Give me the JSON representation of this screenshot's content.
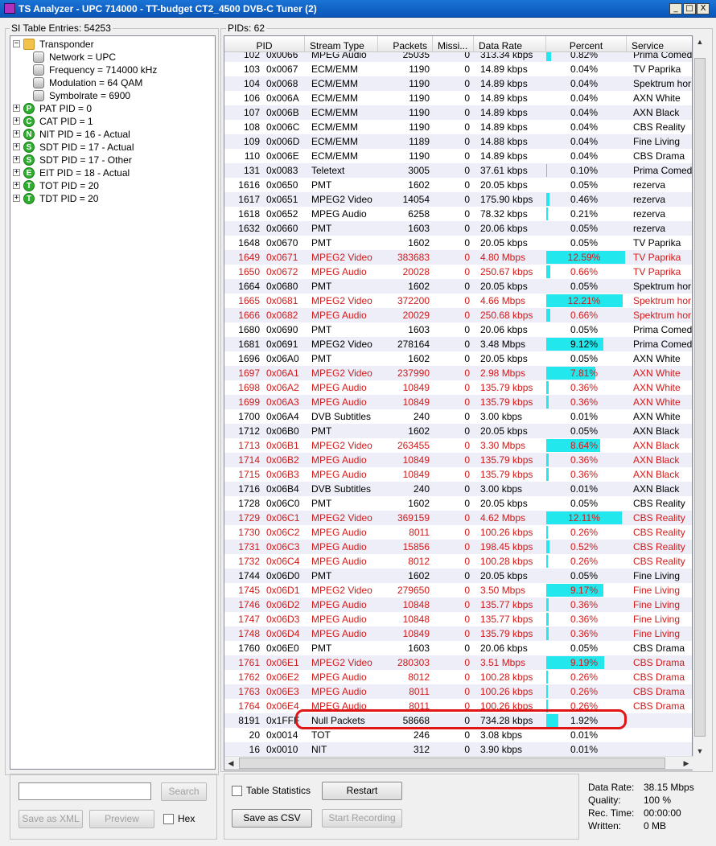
{
  "window": {
    "title": "TS Analyzer - UPC 714000 - TT-budget CT2_4500 DVB-C Tuner (2)",
    "minimize": "_",
    "maximize": "□",
    "close": "X"
  },
  "left_panel": {
    "label": "SI Table Entries: 54253",
    "tree": [
      {
        "label": "Transponder",
        "icon": "folder-icon",
        "expander": "−",
        "level": 0
      },
      {
        "label": "Network = UPC",
        "icon": "gray-node-icon",
        "level": 1
      },
      {
        "label": "Frequency = 714000 kHz",
        "icon": "gray-node-icon",
        "level": 1
      },
      {
        "label": "Modulation = 64 QAM",
        "icon": "gray-node-icon",
        "level": 1
      },
      {
        "label": "Symbolrate = 6900",
        "icon": "gray-node-icon",
        "level": 1
      },
      {
        "label": "PAT PID = 0",
        "icon": "green-node-icon",
        "letter": "P",
        "expander": "+",
        "level": 0
      },
      {
        "label": "CAT PID = 1",
        "icon": "green-node-icon",
        "letter": "C",
        "expander": "+",
        "level": 0
      },
      {
        "label": "NIT PID = 16 - Actual",
        "icon": "green-node-icon",
        "letter": "N",
        "expander": "+",
        "level": 0
      },
      {
        "label": "SDT PID = 17 - Actual",
        "icon": "green-node-icon",
        "letter": "S",
        "expander": "+",
        "level": 0
      },
      {
        "label": "SDT PID = 17 - Other",
        "icon": "green-node-icon",
        "letter": "S",
        "expander": "+",
        "level": 0
      },
      {
        "label": "EIT PID = 18 - Actual",
        "icon": "green-node-icon",
        "letter": "E",
        "expander": "+",
        "level": 0
      },
      {
        "label": "TOT PID = 20",
        "icon": "green-node-icon",
        "letter": "T",
        "expander": "+",
        "level": 0
      },
      {
        "label": "TDT PID = 20",
        "icon": "green-node-icon",
        "letter": "T",
        "expander": "+",
        "level": 0
      }
    ],
    "search_placeholder": "",
    "search_label": "Search",
    "save_xml_label": "Save as XML",
    "preview_label": "Preview",
    "hex_label": "Hex"
  },
  "right_panel": {
    "label": "PIDs: 62",
    "columns": [
      "PID",
      "Stream Type",
      "Packets",
      "Missi...",
      "Data Rate",
      "Percent",
      "Service"
    ],
    "rows": [
      {
        "pid": "102",
        "hex": "0x0066",
        "type": "MPEG Audio",
        "packets": "25035",
        "missing": "0",
        "rate": "313.34 kbps",
        "percent": "0.82%",
        "pct": 0.82,
        "service": "Prima Comed",
        "red": false,
        "clipped": true
      },
      {
        "pid": "103",
        "hex": "0x0067",
        "type": "ECM/EMM",
        "packets": "1190",
        "missing": "0",
        "rate": "14.89 kbps",
        "percent": "0.04%",
        "pct": 0.04,
        "service": "TV Paprika",
        "red": false
      },
      {
        "pid": "104",
        "hex": "0x0068",
        "type": "ECM/EMM",
        "packets": "1190",
        "missing": "0",
        "rate": "14.89 kbps",
        "percent": "0.04%",
        "pct": 0.04,
        "service": "Spektrum hor",
        "red": false
      },
      {
        "pid": "106",
        "hex": "0x006A",
        "type": "ECM/EMM",
        "packets": "1190",
        "missing": "0",
        "rate": "14.89 kbps",
        "percent": "0.04%",
        "pct": 0.04,
        "service": "AXN White",
        "red": false
      },
      {
        "pid": "107",
        "hex": "0x006B",
        "type": "ECM/EMM",
        "packets": "1190",
        "missing": "0",
        "rate": "14.89 kbps",
        "percent": "0.04%",
        "pct": 0.04,
        "service": "AXN Black",
        "red": false
      },
      {
        "pid": "108",
        "hex": "0x006C",
        "type": "ECM/EMM",
        "packets": "1190",
        "missing": "0",
        "rate": "14.89 kbps",
        "percent": "0.04%",
        "pct": 0.04,
        "service": "CBS Reality",
        "red": false
      },
      {
        "pid": "109",
        "hex": "0x006D",
        "type": "ECM/EMM",
        "packets": "1189",
        "missing": "0",
        "rate": "14.88 kbps",
        "percent": "0.04%",
        "pct": 0.04,
        "service": "Fine Living",
        "red": false
      },
      {
        "pid": "110",
        "hex": "0x006E",
        "type": "ECM/EMM",
        "packets": "1190",
        "missing": "0",
        "rate": "14.89 kbps",
        "percent": "0.04%",
        "pct": 0.04,
        "service": "CBS Drama",
        "red": false
      },
      {
        "pid": "131",
        "hex": "0x0083",
        "type": "Teletext",
        "packets": "3005",
        "missing": "0",
        "rate": "37.61 kbps",
        "percent": "0.10%",
        "pct": 0.1,
        "service": "Prima Comed",
        "red": false
      },
      {
        "pid": "1616",
        "hex": "0x0650",
        "type": "PMT",
        "packets": "1602",
        "missing": "0",
        "rate": "20.05 kbps",
        "percent": "0.05%",
        "pct": 0.05,
        "service": "rezerva",
        "red": false
      },
      {
        "pid": "1617",
        "hex": "0x0651",
        "type": "MPEG2 Video",
        "packets": "14054",
        "missing": "0",
        "rate": "175.90 kbps",
        "percent": "0.46%",
        "pct": 0.46,
        "service": "rezerva",
        "red": false
      },
      {
        "pid": "1618",
        "hex": "0x0652",
        "type": "MPEG Audio",
        "packets": "6258",
        "missing": "0",
        "rate": "78.32 kbps",
        "percent": "0.21%",
        "pct": 0.21,
        "service": "rezerva",
        "red": false
      },
      {
        "pid": "1632",
        "hex": "0x0660",
        "type": "PMT",
        "packets": "1603",
        "missing": "0",
        "rate": "20.06 kbps",
        "percent": "0.05%",
        "pct": 0.05,
        "service": "rezerva",
        "red": false
      },
      {
        "pid": "1648",
        "hex": "0x0670",
        "type": "PMT",
        "packets": "1602",
        "missing": "0",
        "rate": "20.05 kbps",
        "percent": "0.05%",
        "pct": 0.05,
        "service": "TV Paprika",
        "red": false
      },
      {
        "pid": "1649",
        "hex": "0x0671",
        "type": "MPEG2 Video",
        "packets": "383683",
        "missing": "0",
        "rate": "4.80 Mbps",
        "percent": "12.59%",
        "pct": 12.59,
        "service": "TV Paprika",
        "red": true
      },
      {
        "pid": "1650",
        "hex": "0x0672",
        "type": "MPEG Audio",
        "packets": "20028",
        "missing": "0",
        "rate": "250.67 kbps",
        "percent": "0.66%",
        "pct": 0.66,
        "service": "TV Paprika",
        "red": true
      },
      {
        "pid": "1664",
        "hex": "0x0680",
        "type": "PMT",
        "packets": "1602",
        "missing": "0",
        "rate": "20.05 kbps",
        "percent": "0.05%",
        "pct": 0.05,
        "service": "Spektrum hor",
        "red": false
      },
      {
        "pid": "1665",
        "hex": "0x0681",
        "type": "MPEG2 Video",
        "packets": "372200",
        "missing": "0",
        "rate": "4.66 Mbps",
        "percent": "12.21%",
        "pct": 12.21,
        "service": "Spektrum hor",
        "red": true
      },
      {
        "pid": "1666",
        "hex": "0x0682",
        "type": "MPEG Audio",
        "packets": "20029",
        "missing": "0",
        "rate": "250.68 kbps",
        "percent": "0.66%",
        "pct": 0.66,
        "service": "Spektrum hor",
        "red": true
      },
      {
        "pid": "1680",
        "hex": "0x0690",
        "type": "PMT",
        "packets": "1603",
        "missing": "0",
        "rate": "20.06 kbps",
        "percent": "0.05%",
        "pct": 0.05,
        "service": "Prima Comed",
        "red": false
      },
      {
        "pid": "1681",
        "hex": "0x0691",
        "type": "MPEG2 Video",
        "packets": "278164",
        "missing": "0",
        "rate": "3.48 Mbps",
        "percent": "9.12%",
        "pct": 9.12,
        "service": "Prima Comed",
        "red": false
      },
      {
        "pid": "1696",
        "hex": "0x06A0",
        "type": "PMT",
        "packets": "1602",
        "missing": "0",
        "rate": "20.05 kbps",
        "percent": "0.05%",
        "pct": 0.05,
        "service": "AXN White",
        "red": false
      },
      {
        "pid": "1697",
        "hex": "0x06A1",
        "type": "MPEG2 Video",
        "packets": "237990",
        "missing": "0",
        "rate": "2.98 Mbps",
        "percent": "7.81%",
        "pct": 7.81,
        "service": "AXN White",
        "red": true
      },
      {
        "pid": "1698",
        "hex": "0x06A2",
        "type": "MPEG Audio",
        "packets": "10849",
        "missing": "0",
        "rate": "135.79 kbps",
        "percent": "0.36%",
        "pct": 0.36,
        "service": "AXN White",
        "red": true
      },
      {
        "pid": "1699",
        "hex": "0x06A3",
        "type": "MPEG Audio",
        "packets": "10849",
        "missing": "0",
        "rate": "135.79 kbps",
        "percent": "0.36%",
        "pct": 0.36,
        "service": "AXN White",
        "red": true
      },
      {
        "pid": "1700",
        "hex": "0x06A4",
        "type": "DVB Subtitles",
        "packets": "240",
        "missing": "0",
        "rate": "3.00 kbps",
        "percent": "0.01%",
        "pct": 0.01,
        "service": "AXN White",
        "red": false
      },
      {
        "pid": "1712",
        "hex": "0x06B0",
        "type": "PMT",
        "packets": "1602",
        "missing": "0",
        "rate": "20.05 kbps",
        "percent": "0.05%",
        "pct": 0.05,
        "service": "AXN Black",
        "red": false
      },
      {
        "pid": "1713",
        "hex": "0x06B1",
        "type": "MPEG2 Video",
        "packets": "263455",
        "missing": "0",
        "rate": "3.30 Mbps",
        "percent": "8.64%",
        "pct": 8.64,
        "service": "AXN Black",
        "red": true
      },
      {
        "pid": "1714",
        "hex": "0x06B2",
        "type": "MPEG Audio",
        "packets": "10849",
        "missing": "0",
        "rate": "135.79 kbps",
        "percent": "0.36%",
        "pct": 0.36,
        "service": "AXN Black",
        "red": true
      },
      {
        "pid": "1715",
        "hex": "0x06B3",
        "type": "MPEG Audio",
        "packets": "10849",
        "missing": "0",
        "rate": "135.79 kbps",
        "percent": "0.36%",
        "pct": 0.36,
        "service": "AXN Black",
        "red": true
      },
      {
        "pid": "1716",
        "hex": "0x06B4",
        "type": "DVB Subtitles",
        "packets": "240",
        "missing": "0",
        "rate": "3.00 kbps",
        "percent": "0.01%",
        "pct": 0.01,
        "service": "AXN Black",
        "red": false
      },
      {
        "pid": "1728",
        "hex": "0x06C0",
        "type": "PMT",
        "packets": "1602",
        "missing": "0",
        "rate": "20.05 kbps",
        "percent": "0.05%",
        "pct": 0.05,
        "service": "CBS Reality",
        "red": false
      },
      {
        "pid": "1729",
        "hex": "0x06C1",
        "type": "MPEG2 Video",
        "packets": "369159",
        "missing": "0",
        "rate": "4.62 Mbps",
        "percent": "12.11%",
        "pct": 12.11,
        "service": "CBS Reality",
        "red": true
      },
      {
        "pid": "1730",
        "hex": "0x06C2",
        "type": "MPEG Audio",
        "packets": "8011",
        "missing": "0",
        "rate": "100.26 kbps",
        "percent": "0.26%",
        "pct": 0.26,
        "service": "CBS Reality",
        "red": true
      },
      {
        "pid": "1731",
        "hex": "0x06C3",
        "type": "MPEG Audio",
        "packets": "15856",
        "missing": "0",
        "rate": "198.45 kbps",
        "percent": "0.52%",
        "pct": 0.52,
        "service": "CBS Reality",
        "red": true
      },
      {
        "pid": "1732",
        "hex": "0x06C4",
        "type": "MPEG Audio",
        "packets": "8012",
        "missing": "0",
        "rate": "100.28 kbps",
        "percent": "0.26%",
        "pct": 0.26,
        "service": "CBS Reality",
        "red": true
      },
      {
        "pid": "1744",
        "hex": "0x06D0",
        "type": "PMT",
        "packets": "1602",
        "missing": "0",
        "rate": "20.05 kbps",
        "percent": "0.05%",
        "pct": 0.05,
        "service": "Fine Living",
        "red": false
      },
      {
        "pid": "1745",
        "hex": "0x06D1",
        "type": "MPEG2 Video",
        "packets": "279650",
        "missing": "0",
        "rate": "3.50 Mbps",
        "percent": "9.17%",
        "pct": 9.17,
        "service": "Fine Living",
        "red": true
      },
      {
        "pid": "1746",
        "hex": "0x06D2",
        "type": "MPEG Audio",
        "packets": "10848",
        "missing": "0",
        "rate": "135.77 kbps",
        "percent": "0.36%",
        "pct": 0.36,
        "service": "Fine Living",
        "red": true
      },
      {
        "pid": "1747",
        "hex": "0x06D3",
        "type": "MPEG Audio",
        "packets": "10848",
        "missing": "0",
        "rate": "135.77 kbps",
        "percent": "0.36%",
        "pct": 0.36,
        "service": "Fine Living",
        "red": true
      },
      {
        "pid": "1748",
        "hex": "0x06D4",
        "type": "MPEG Audio",
        "packets": "10849",
        "missing": "0",
        "rate": "135.79 kbps",
        "percent": "0.36%",
        "pct": 0.36,
        "service": "Fine Living",
        "red": true
      },
      {
        "pid": "1760",
        "hex": "0x06E0",
        "type": "PMT",
        "packets": "1603",
        "missing": "0",
        "rate": "20.06 kbps",
        "percent": "0.05%",
        "pct": 0.05,
        "service": "CBS Drama",
        "red": false
      },
      {
        "pid": "1761",
        "hex": "0x06E1",
        "type": "MPEG2 Video",
        "packets": "280303",
        "missing": "0",
        "rate": "3.51 Mbps",
        "percent": "9.19%",
        "pct": 9.19,
        "service": "CBS Drama",
        "red": true
      },
      {
        "pid": "1762",
        "hex": "0x06E2",
        "type": "MPEG Audio",
        "packets": "8012",
        "missing": "0",
        "rate": "100.28 kbps",
        "percent": "0.26%",
        "pct": 0.26,
        "service": "CBS Drama",
        "red": true
      },
      {
        "pid": "1763",
        "hex": "0x06E3",
        "type": "MPEG Audio",
        "packets": "8011",
        "missing": "0",
        "rate": "100.26 kbps",
        "percent": "0.26%",
        "pct": 0.26,
        "service": "CBS Drama",
        "red": true
      },
      {
        "pid": "1764",
        "hex": "0x06E4",
        "type": "MPEG Audio",
        "packets": "8011",
        "missing": "0",
        "rate": "100.26 kbps",
        "percent": "0.26%",
        "pct": 0.26,
        "service": "CBS Drama",
        "red": true
      },
      {
        "pid": "8191",
        "hex": "0x1FFF",
        "type": "Null Packets",
        "packets": "58668",
        "missing": "0",
        "rate": "734.28 kbps",
        "percent": "1.92%",
        "pct": 1.92,
        "service": "",
        "red": false
      },
      {
        "pid": "20",
        "hex": "0x0014",
        "type": "TOT",
        "packets": "246",
        "missing": "0",
        "rate": "3.08 kbps",
        "percent": "0.01%",
        "pct": 0.01,
        "service": "",
        "red": false
      },
      {
        "pid": "16",
        "hex": "0x0010",
        "type": "NIT",
        "packets": "312",
        "missing": "0",
        "rate": "3.90 kbps",
        "percent": "0.01%",
        "pct": 0.01,
        "service": "",
        "red": false
      }
    ],
    "percent_bar_max": 12.59,
    "table_statistics_label": "Table Statistics",
    "restart_label": "Restart",
    "save_csv_label": "Save as CSV",
    "start_recording_label": "Start Recording"
  },
  "stats": {
    "data_rate_label": "Data Rate:",
    "data_rate_value": "38.15 Mbps",
    "quality_label": "Quality:",
    "quality_value": "100 %",
    "rec_time_label": "Rec. Time:",
    "rec_time_value": "00:00:00",
    "written_label": "Written:",
    "written_value": "0 MB"
  },
  "colors": {
    "red_row": "#d11a1a",
    "bar": "#22e8ee",
    "titlebar": "#0a56b8",
    "highlight": "#e01515"
  }
}
